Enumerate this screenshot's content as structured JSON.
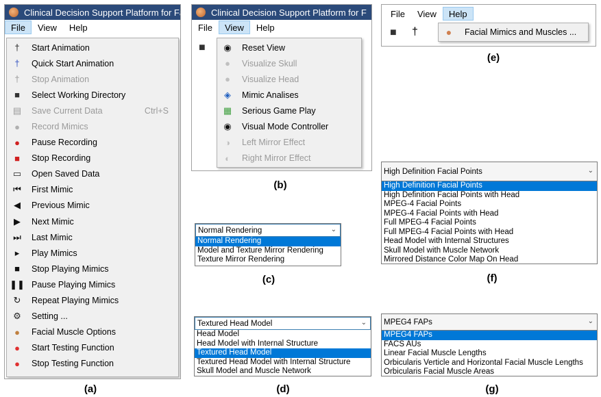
{
  "panel_a": {
    "title": "Clinical Decision Support Platform for Fac",
    "menubar": [
      "File",
      "View",
      "Help"
    ],
    "items": [
      {
        "label": "Start Animation",
        "icon": "running-figure-icon",
        "glyph": "†",
        "color": "#222222",
        "disabled": false,
        "shortcut": ""
      },
      {
        "label": "Quick Start Animation",
        "icon": "quick-run-icon",
        "glyph": "†",
        "color": "#3050c0",
        "disabled": false,
        "shortcut": ""
      },
      {
        "label": "Stop Animation",
        "icon": "stop-run-icon",
        "glyph": "†",
        "color": "#9a9a9a",
        "disabled": true,
        "shortcut": ""
      },
      {
        "label": "Select Working Directory",
        "icon": "folder-select-icon",
        "glyph": "■",
        "color": "#333333",
        "disabled": false,
        "shortcut": ""
      },
      {
        "label": "Save Current Data",
        "icon": "save-disk-icon",
        "glyph": "▤",
        "color": "#9a9a9a",
        "disabled": true,
        "shortcut": "Ctrl+S"
      },
      {
        "label": "Record Mimics",
        "icon": "record-icon",
        "glyph": "●",
        "color": "#b0b0b0",
        "disabled": true,
        "shortcut": ""
      },
      {
        "label": "Pause Recording",
        "icon": "pause-recording-icon",
        "glyph": "●",
        "color": "#d02020",
        "disabled": false,
        "shortcut": ""
      },
      {
        "label": "Stop Recording",
        "icon": "stop-recording-icon",
        "glyph": "■",
        "color": "#d02020",
        "disabled": false,
        "shortcut": ""
      },
      {
        "label": "Open Saved Data",
        "icon": "open-folder-icon",
        "glyph": "▭",
        "color": "#222222",
        "disabled": false,
        "shortcut": ""
      },
      {
        "label": "First Mimic",
        "icon": "first-mimic-icon",
        "glyph": "⏮",
        "color": "#111111",
        "disabled": false,
        "shortcut": ""
      },
      {
        "label": "Previous Mimic",
        "icon": "previous-mimic-icon",
        "glyph": "◀",
        "color": "#111111",
        "disabled": false,
        "shortcut": ""
      },
      {
        "label": "Next Mimic",
        "icon": "next-mimic-icon",
        "glyph": "▶",
        "color": "#111111",
        "disabled": false,
        "shortcut": ""
      },
      {
        "label": "Last Mimic",
        "icon": "last-mimic-icon",
        "glyph": "⏭",
        "color": "#111111",
        "disabled": false,
        "shortcut": ""
      },
      {
        "label": "Play Mimics",
        "icon": "play-icon",
        "glyph": "▸",
        "color": "#111111",
        "disabled": false,
        "shortcut": ""
      },
      {
        "label": "Stop Playing Mimics",
        "icon": "stop-icon",
        "glyph": "■",
        "color": "#111111",
        "disabled": false,
        "shortcut": ""
      },
      {
        "label": "Pause Playing Mimics",
        "icon": "pause-icon",
        "glyph": "❚❚",
        "color": "#111111",
        "disabled": false,
        "shortcut": ""
      },
      {
        "label": "Repeat Playing Mimics",
        "icon": "repeat-icon",
        "glyph": "↻",
        "color": "#111111",
        "disabled": false,
        "shortcut": ""
      },
      {
        "label": "Setting ...",
        "icon": "gear-icon",
        "glyph": "⚙",
        "color": "#222222",
        "disabled": false,
        "shortcut": ""
      },
      {
        "label": "Facial Muscle Options",
        "icon": "face-muscle-icon",
        "glyph": "●",
        "color": "#c08040",
        "disabled": false,
        "shortcut": ""
      },
      {
        "label": "Start Testing Function",
        "icon": "test-start-icon",
        "glyph": "●",
        "color": "#e03030",
        "disabled": false,
        "shortcut": ""
      },
      {
        "label": "Stop Testing Function",
        "icon": "test-stop-icon",
        "glyph": "●",
        "color": "#e03030",
        "disabled": false,
        "shortcut": ""
      }
    ],
    "caption": "(a)"
  },
  "panel_b": {
    "title": "Clinical Decision Support Platform for F",
    "menubar": [
      "File",
      "View",
      "Help"
    ],
    "items": [
      {
        "label": "Reset View",
        "icon": "eye-glasses-icon",
        "glyph": "◉",
        "color": "#111111",
        "disabled": false
      },
      {
        "label": "Visualize Skull",
        "icon": "skull-icon",
        "glyph": "●",
        "color": "#c0c0c0",
        "disabled": true
      },
      {
        "label": "Visualize Head",
        "icon": "head-icon",
        "glyph": "●",
        "color": "#c0c0c0",
        "disabled": true
      },
      {
        "label": "Mimic Analises",
        "icon": "analysis-icon",
        "glyph": "◈",
        "color": "#2060c0",
        "disabled": false
      },
      {
        "label": "Serious Game Play",
        "icon": "game-icon",
        "glyph": "▦",
        "color": "#40a040",
        "disabled": false
      },
      {
        "label": "Visual Mode Controller",
        "icon": "eye-icon",
        "glyph": "◉",
        "color": "#111111",
        "disabled": false
      },
      {
        "label": "Left Mirror Effect",
        "icon": "left-mirror-icon",
        "glyph": "◑",
        "color": "#c0c0c0",
        "disabled": true
      },
      {
        "label": "Right Mirror Effect",
        "icon": "right-mirror-icon",
        "glyph": "◐",
        "color": "#c0c0c0",
        "disabled": true
      }
    ],
    "caption": "(b)"
  },
  "panel_c": {
    "selected": "Normal Rendering",
    "options": [
      "Normal Rendering",
      "Model and Texture Mirror Rendering",
      "Texture Mirror Rendering"
    ],
    "caption": "(c)"
  },
  "panel_d": {
    "selected": "Textured Head Model",
    "options": [
      "Head Model",
      "Head Model with Internal Structure",
      "Textured Head Model",
      "Textured Head Model with Internal Structure",
      "Skull Model and Muscle Network"
    ],
    "caption": "(d)"
  },
  "panel_e": {
    "menubar": [
      "File",
      "View",
      "Help"
    ],
    "menu_item": "Facial Mimics and Muscles ...",
    "caption": "(e)"
  },
  "panel_f": {
    "selected": "High Definition Facial Points",
    "options": [
      "High Definition Facial Points",
      "High Definition Facial Points with Head",
      "MPEG-4 Facial Points",
      "MPEG-4 Facial Points with Head",
      "Full MPEG-4 Facial Points",
      "Full MPEG-4 Facial Points with Head",
      "Head Model with Internal Structures",
      "Skull Model with Muscle Network",
      "Mirrored Distance Color Map On Head"
    ],
    "caption": "(f)"
  },
  "panel_g": {
    "selected": "MPEG4 FAPs",
    "options": [
      "MPEG4 FAPs",
      "FACS AUs",
      "Linear Facial Muscle Lengths",
      "Orbicularis Verticle and Horizontal Facial Muscle Lengths",
      "Orbicularis Facial Muscle Areas"
    ],
    "caption": "(g)"
  },
  "colors": {
    "titlebar": "#2b4a7a",
    "selection": "#0078d7",
    "menu_bg": "#f0f0f0",
    "menubar_active": "#cce4f7"
  }
}
